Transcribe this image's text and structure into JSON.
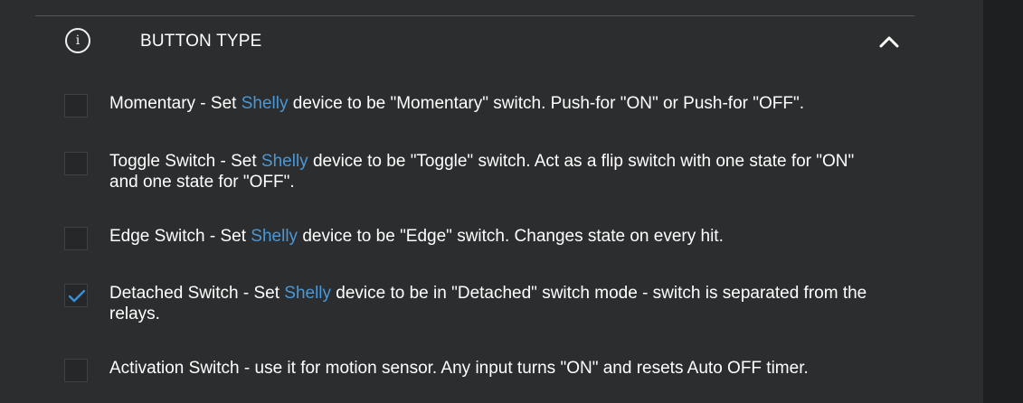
{
  "section": {
    "title": "BUTTON TYPE",
    "info_icon": "info-icon",
    "toggle_icon": "chevron-up-icon"
  },
  "colors": {
    "background": "#2b2d2e",
    "link": "#4a98d8",
    "check": "#3b8fd6"
  },
  "options": [
    {
      "checked": false,
      "prefix": "Momentary - Set ",
      "link": "Shelly",
      "suffix": " device to be \"Momentary\" switch. Push-for \"ON\" or Push-for \"OFF\"."
    },
    {
      "checked": false,
      "prefix": "Toggle Switch - Set ",
      "link": "Shelly",
      "suffix": " device to be \"Toggle\" switch. Act as a flip switch with one state for \"ON\" and one state for \"OFF\"."
    },
    {
      "checked": false,
      "prefix": "Edge Switch - Set ",
      "link": "Shelly",
      "suffix": " device to be \"Edge\" switch. Changes state on every hit."
    },
    {
      "checked": true,
      "prefix": "Detached Switch - Set ",
      "link": "Shelly",
      "suffix": " device to be in \"Detached\" switch mode - switch is separated from the relays."
    },
    {
      "checked": false,
      "prefix": "Activation Switch - use it for motion sensor. Any input turns \"ON\" and resets Auto OFF timer.",
      "link": "",
      "suffix": ""
    }
  ]
}
